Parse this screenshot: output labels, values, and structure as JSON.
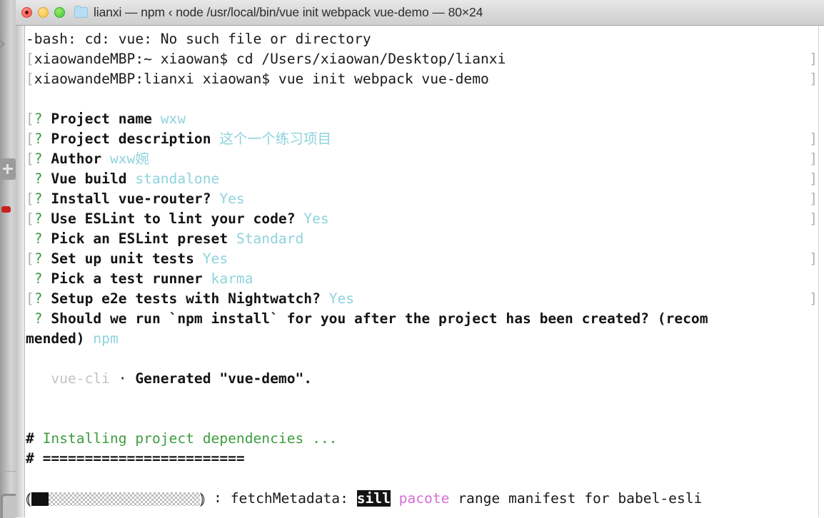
{
  "window": {
    "title": "lianxi — npm ‹ node /usr/local/bin/vue init webpack vue-demo — 80×24",
    "folder_icon": "folder-icon",
    "traffic_lights": {
      "close": "close-button",
      "minimize": "minimize-button",
      "maximize": "maximize-button"
    }
  },
  "terminal": {
    "size": "80×24",
    "lines": [
      {
        "id": "l1",
        "bracket_right": false,
        "segments": [
          {
            "text": "-bash: cd: vue: No such file or directory",
            "style": "default"
          }
        ]
      },
      {
        "id": "l2",
        "bracket_left": "[",
        "bracket_right": true,
        "segments": [
          {
            "text": "xiaowandeMBP:~ xiaowan$ cd /Users/xiaowan/Desktop/lianxi",
            "style": "default"
          }
        ]
      },
      {
        "id": "l3",
        "bracket_left": "[",
        "bracket_right": true,
        "segments": [
          {
            "text": "xiaowandeMBP:lianxi xiaowan$ vue init webpack vue-demo",
            "style": "default"
          }
        ]
      },
      {
        "id": "l4",
        "bracket_right": false,
        "segments": []
      },
      {
        "id": "l5",
        "bracket_left": "[",
        "bracket_right": false,
        "segments": [
          {
            "text": "? ",
            "style": "green"
          },
          {
            "text": "Project name ",
            "style": "bold"
          },
          {
            "text": "wxw",
            "style": "cyan"
          }
        ]
      },
      {
        "id": "l6",
        "bracket_left": "[",
        "bracket_right": true,
        "segments": [
          {
            "text": "? ",
            "style": "green"
          },
          {
            "text": "Project description ",
            "style": "bold"
          },
          {
            "text": "这个一个练习项目",
            "style": "cyan"
          }
        ]
      },
      {
        "id": "l7",
        "bracket_left": "[",
        "bracket_right": true,
        "segments": [
          {
            "text": "? ",
            "style": "green"
          },
          {
            "text": "Author ",
            "style": "bold"
          },
          {
            "text": "wxw婉",
            "style": "cyan"
          }
        ]
      },
      {
        "id": "l8",
        "bracket_left": " ",
        "bracket_right": true,
        "segments": [
          {
            "text": "? ",
            "style": "green"
          },
          {
            "text": "Vue build ",
            "style": "bold"
          },
          {
            "text": "standalone",
            "style": "cyan"
          }
        ]
      },
      {
        "id": "l9",
        "bracket_left": "[",
        "bracket_right": true,
        "segments": [
          {
            "text": "? ",
            "style": "green"
          },
          {
            "text": "Install vue-router? ",
            "style": "bold"
          },
          {
            "text": "Yes",
            "style": "cyan"
          }
        ]
      },
      {
        "id": "l10",
        "bracket_left": "[",
        "bracket_right": true,
        "segments": [
          {
            "text": "? ",
            "style": "green"
          },
          {
            "text": "Use ESLint to lint your code? ",
            "style": "bold"
          },
          {
            "text": "Yes",
            "style": "cyan"
          }
        ]
      },
      {
        "id": "l11",
        "bracket_left": " ",
        "bracket_right": false,
        "segments": [
          {
            "text": "? ",
            "style": "green"
          },
          {
            "text": "Pick an ESLint preset ",
            "style": "bold"
          },
          {
            "text": "Standard",
            "style": "cyan"
          }
        ]
      },
      {
        "id": "l12",
        "bracket_left": "[",
        "bracket_right": true,
        "segments": [
          {
            "text": "? ",
            "style": "green"
          },
          {
            "text": "Set up unit tests ",
            "style": "bold"
          },
          {
            "text": "Yes",
            "style": "cyan"
          }
        ]
      },
      {
        "id": "l13",
        "bracket_left": " ",
        "bracket_right": false,
        "segments": [
          {
            "text": "? ",
            "style": "green"
          },
          {
            "text": "Pick a test runner ",
            "style": "bold"
          },
          {
            "text": "karma",
            "style": "cyan"
          }
        ]
      },
      {
        "id": "l14",
        "bracket_left": "[",
        "bracket_right": true,
        "segments": [
          {
            "text": "? ",
            "style": "green"
          },
          {
            "text": "Setup e2e tests with Nightwatch? ",
            "style": "bold"
          },
          {
            "text": "Yes",
            "style": "cyan"
          }
        ]
      },
      {
        "id": "l15",
        "bracket_left": " ",
        "bracket_right": false,
        "segments": [
          {
            "text": "? ",
            "style": "green"
          },
          {
            "text": "Should we run `npm install` for you after the project has been created? (recom",
            "style": "bold"
          }
        ]
      },
      {
        "id": "l16",
        "bracket_right": false,
        "segments": [
          {
            "text": "mended) ",
            "style": "bold"
          },
          {
            "text": "npm",
            "style": "cyan"
          }
        ]
      },
      {
        "id": "l17",
        "bracket_right": false,
        "segments": []
      },
      {
        "id": "l18",
        "bracket_right": false,
        "segments": [
          {
            "text": "   vue-cli",
            "style": "gray"
          },
          {
            "text": " · ",
            "style": "default"
          },
          {
            "text": "Generated \"vue-demo\".",
            "style": "bold"
          }
        ]
      },
      {
        "id": "l19",
        "bracket_right": false,
        "segments": []
      },
      {
        "id": "l20",
        "bracket_right": false,
        "segments": []
      },
      {
        "id": "l21",
        "bracket_right": false,
        "segments": [
          {
            "text": "# ",
            "style": "bold"
          },
          {
            "text": "Installing project dependencies ...",
            "style": "green"
          }
        ]
      },
      {
        "id": "l22",
        "bracket_right": false,
        "segments": [
          {
            "text": "# ========================",
            "style": "bold"
          }
        ]
      },
      {
        "id": "l23",
        "bracket_right": false,
        "segments": []
      }
    ],
    "progress_line": {
      "left_paren": "⦅",
      "right_paren": "⦆",
      "fill_percent": 10,
      "separator": "∶",
      "phase": "fetchMetadata:",
      "level": "sill",
      "module": "pacote",
      "message": "range manifest for babel-esli"
    }
  },
  "colors": {
    "green": "#3f9c3f",
    "cyan": "#8fd3dd",
    "gray": "#c3c3c3",
    "magenta": "#d66fd6",
    "foreground": "#1a1a1a",
    "background": "#ffffff",
    "close_light": "#ef554c",
    "minimize_light": "#f5bf44",
    "maximize_light": "#45c93b"
  }
}
